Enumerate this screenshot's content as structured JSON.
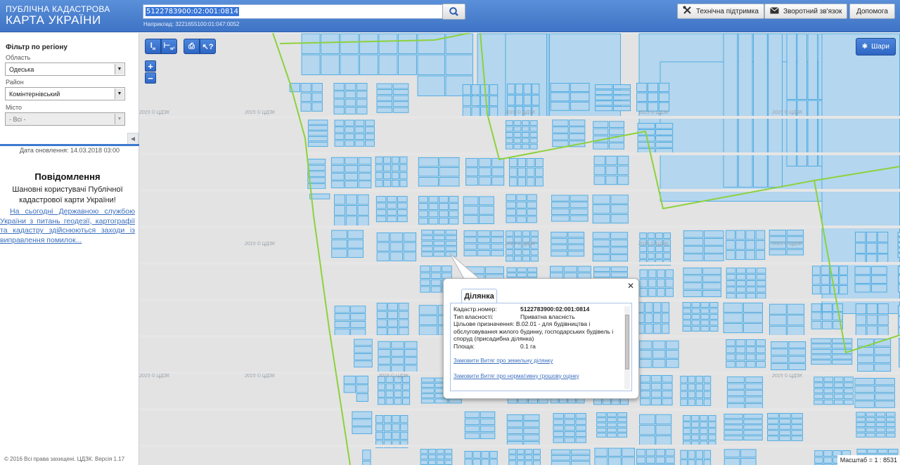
{
  "header": {
    "logo_line1": "ПУБЛІЧНА КАДАСТРОВА",
    "logo_line2": "КАРТА УКРАЇНИ",
    "search_value": "5122783900:02:001:0814",
    "example_text": "Наприклад: 3221655100:01:047:0052",
    "buttons": {
      "support": "Технічна підтримка",
      "feedback": "Зворотний зв'язок",
      "help": "Допомога"
    }
  },
  "sidebar": {
    "filter_title": "Фільтр по регіону",
    "region_label": "Область",
    "region_value": "Одеська",
    "district_label": "Район",
    "district_value": "Комінтернівський",
    "city_label": "Місто",
    "city_value": "- Всі -",
    "update_date": "Дата оновлення: 14.03.2018 03:00",
    "notice_title": "Повідомлення",
    "notice_text": "Шановні користувачі Публічної кадастрової карти України!",
    "notice_link": "На сьогодні Державною службою України з питань геодезії, картографії та кадастру здійснюються заходи із виправлення помилок...",
    "footer": "© 2016 Всі права захищені. ЦДЗК. Версія 1.17"
  },
  "map": {
    "layers_label": "Шари",
    "zoom_in": "+",
    "zoom_out": "−",
    "scale_text": "Масштаб = 1 : 8531",
    "watermark": "2015 © ЦДЗК",
    "colors": {
      "parcel_fill": "#b4d6ee",
      "parcel_stroke": "#3aa3e0",
      "boundary": "#8cd23c",
      "background": "#e3e3e3"
    }
  },
  "popup": {
    "tab": "Ділянка",
    "fields": [
      {
        "key": "Кадастр.номер:",
        "value": "5122783900:02:001:0814"
      },
      {
        "key": "Тип власності:",
        "value": "Приватна власність"
      },
      {
        "key": "Цільове призначення:",
        "value": "В.02.01 - для будівництва і обслуговування жилого будинку, господарських будівель і споруд (присадибна ділянка)"
      },
      {
        "key": "Площа:",
        "value": "0.1 га"
      }
    ],
    "link1": "Замовити Витяг про земельну ділянку",
    "link2": "Замовити Витяг про нормативну грошову оцінку"
  }
}
